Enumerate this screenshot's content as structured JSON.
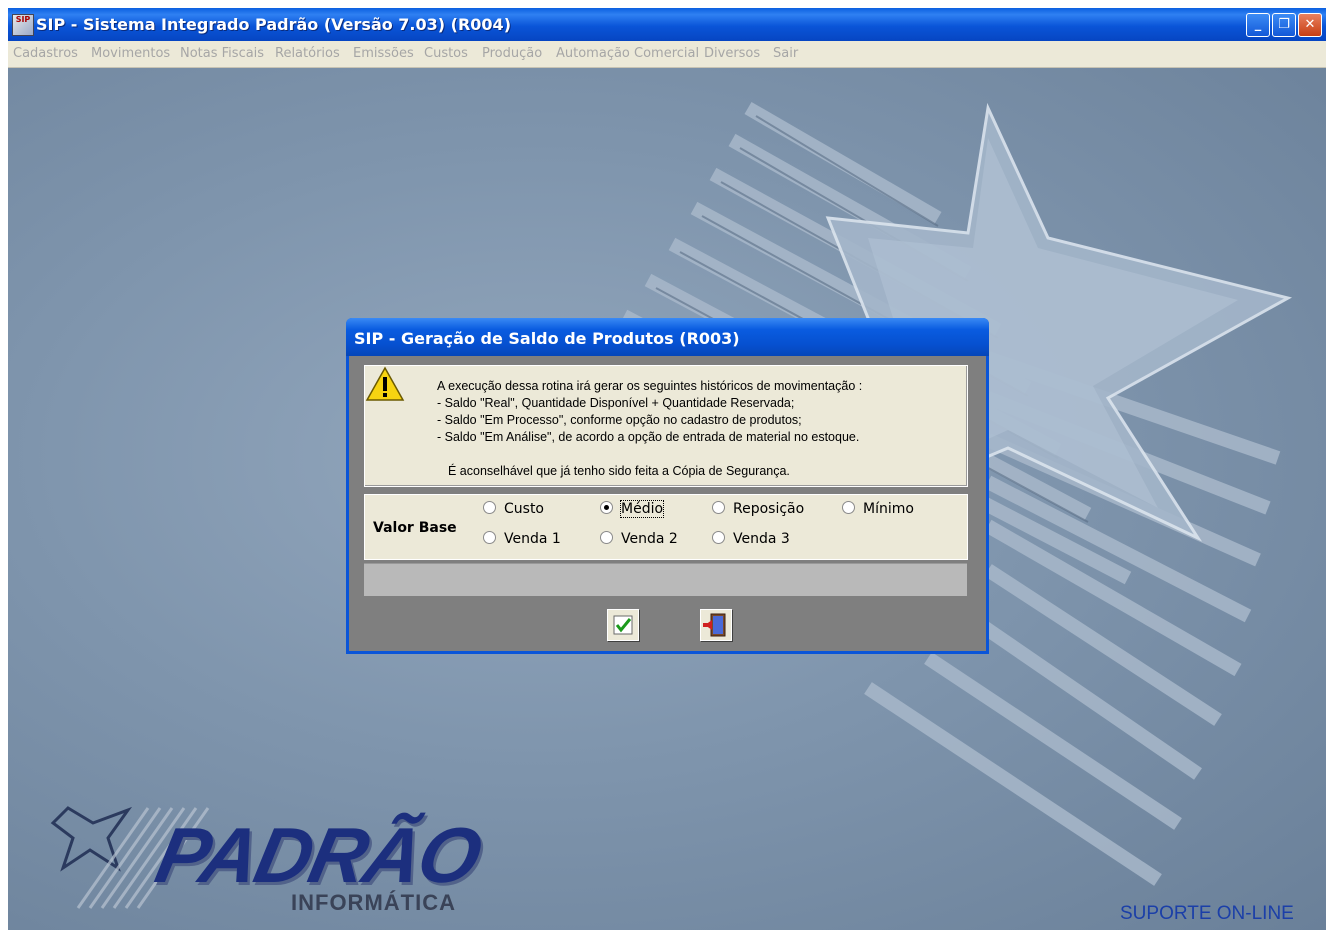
{
  "window": {
    "icon_text": "SIP",
    "title": "SIP - Sistema Integrado Padrão  (Versão  7.03) (R004)",
    "minimize": "_",
    "restore": "❐",
    "close": "✕"
  },
  "menu": [
    "Cadastros",
    "Movimentos",
    "Notas Fiscais",
    "Relatórios",
    "Emissões",
    "Custos",
    "Produção",
    "Automação Comercial",
    "Diversos",
    "Sair"
  ],
  "dialog": {
    "title": "SIP - Geração de Saldo de Produtos  (R003)",
    "message": [
      "A execução dessa rotina irá gerar os seguintes históricos de movimentação :",
      "- Saldo \"Real\",  Quantidade Disponível  +  Quantidade Reservada;",
      "- Saldo \"Em Processo\", conforme opção no cadastro de produtos;",
      "- Saldo \"Em Análise\", de acordo a opção de entrada de material no estoque.",
      "É aconselhável que já tenho sido feita a Cópia de Segurança."
    ],
    "option_group_label": "Valor Base",
    "options": [
      {
        "label": "Custo",
        "checked": false
      },
      {
        "label": "Médio",
        "checked": true
      },
      {
        "label": "Reposição",
        "checked": false
      },
      {
        "label": "Mínimo",
        "checked": false
      },
      {
        "label": "Venda 1",
        "checked": false
      },
      {
        "label": "Venda 2",
        "checked": false
      },
      {
        "label": "Venda 3",
        "checked": false
      }
    ],
    "confirm_icon": "check-icon",
    "exit_icon": "exit-door-icon"
  },
  "branding": {
    "logo": "PADRÃO",
    "logo_sub": "INFORMÁTICA",
    "support": "SUPORTE ON-LINE"
  }
}
